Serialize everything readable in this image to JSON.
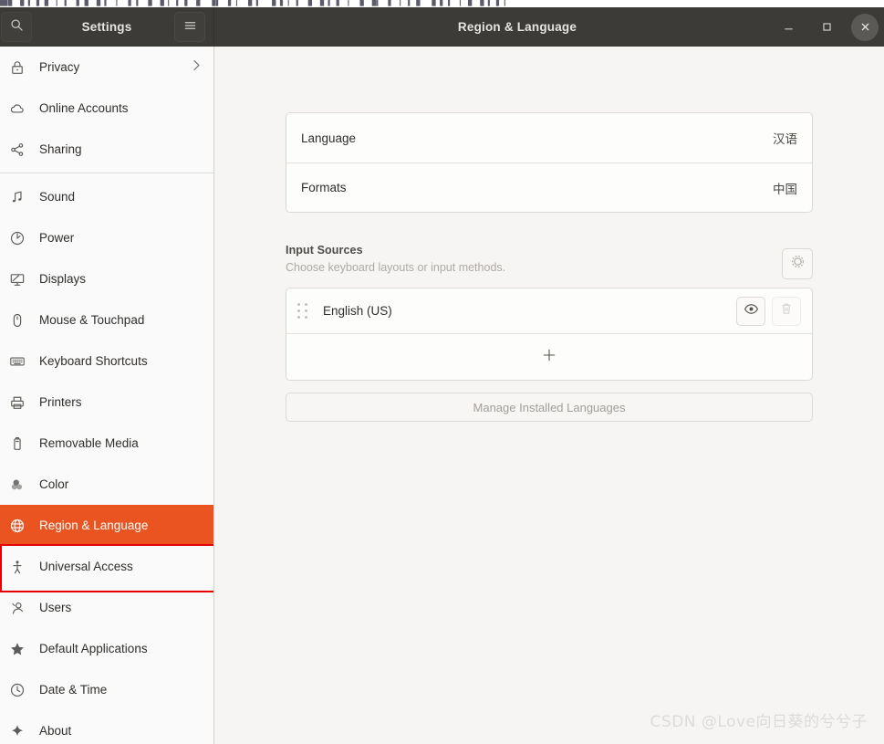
{
  "background_window": {
    "ghost_text": "█▌▐ ▎▍▌ ▏▎ ▍▌▐ ▎ ▏ ▍▎ ▌▐ ▏▎▍ ▌ ▐▎ ▍▏ ▌▎ ▐ ▍▏▎ ▌▐ ▎▍ ▏ ▌▐▎ ▍ ▏▎▌ ▐ ▍▎ ▏▌▐ ▎▍▏"
  },
  "titlebar": {
    "app_title": "Settings",
    "page_title": "Region & Language",
    "search_icon": "search-icon",
    "menu_icon": "hamburger-menu-icon",
    "minimize_label": "–",
    "maximize_label": "□",
    "close_label": "×"
  },
  "sidebar": {
    "items": [
      {
        "label": "Privacy",
        "icon": "lock-icon",
        "chevron": true,
        "selected": false,
        "separator_after": false
      },
      {
        "label": "Online Accounts",
        "icon": "cloud-icon",
        "chevron": false,
        "selected": false,
        "separator_after": false
      },
      {
        "label": "Sharing",
        "icon": "share-nodes-icon",
        "chevron": false,
        "selected": false,
        "separator_after": true
      },
      {
        "label": "Sound",
        "icon": "music-note-icon",
        "chevron": false,
        "selected": false,
        "separator_after": false
      },
      {
        "label": "Power",
        "icon": "power-icon",
        "chevron": false,
        "selected": false,
        "separator_after": false
      },
      {
        "label": "Displays",
        "icon": "monitor-icon",
        "chevron": false,
        "selected": false,
        "separator_after": false
      },
      {
        "label": "Mouse & Touchpad",
        "icon": "mouse-icon",
        "chevron": false,
        "selected": false,
        "separator_after": false
      },
      {
        "label": "Keyboard Shortcuts",
        "icon": "keyboard-icon",
        "chevron": false,
        "selected": false,
        "separator_after": false
      },
      {
        "label": "Printers",
        "icon": "printer-icon",
        "chevron": false,
        "selected": false,
        "separator_after": false
      },
      {
        "label": "Removable Media",
        "icon": "usb-drive-icon",
        "chevron": false,
        "selected": false,
        "separator_after": false
      },
      {
        "label": "Color",
        "icon": "color-circles-icon",
        "chevron": false,
        "selected": false,
        "separator_after": false
      },
      {
        "label": "Region & Language",
        "icon": "globe-icon",
        "chevron": false,
        "selected": true,
        "separator_after": false
      },
      {
        "label": "Universal Access",
        "icon": "accessibility-icon",
        "chevron": false,
        "selected": false,
        "separator_after": false
      },
      {
        "label": "Users",
        "icon": "users-icon",
        "chevron": false,
        "selected": false,
        "separator_after": false
      },
      {
        "label": "Default Applications",
        "icon": "star-icon",
        "chevron": false,
        "selected": false,
        "separator_after": false
      },
      {
        "label": "Date & Time",
        "icon": "clock-icon",
        "chevron": false,
        "selected": false,
        "separator_after": false
      },
      {
        "label": "About",
        "icon": "sparkle-icon",
        "chevron": false,
        "selected": false,
        "separator_after": false
      }
    ],
    "selected_index": 11
  },
  "main": {
    "language_row": {
      "label": "Language",
      "value": "汉语"
    },
    "formats_row": {
      "label": "Formats",
      "value": "中国"
    },
    "input_sources": {
      "title": "Input Sources",
      "subtitle": "Choose keyboard layouts or input methods.",
      "settings_icon": "gear-icon",
      "entries": [
        {
          "name": "English (US)",
          "drag_handle_icon": "drag-handle-icon",
          "preview_icon": "eye-icon",
          "remove_icon": "trash-icon",
          "remove_enabled": false
        }
      ],
      "add_icon": "plus-icon"
    },
    "manage_button": "Manage Installed Languages"
  },
  "watermark": {
    "text": "CSDN @Love向日葵的兮兮子"
  },
  "colors": {
    "accent_orange": "#e95420",
    "annotation_red": "#e50000",
    "titlebar_dark": "#3c3b37",
    "sidebar_bg": "#fbfafa",
    "content_bg": "#f6f5f4"
  }
}
